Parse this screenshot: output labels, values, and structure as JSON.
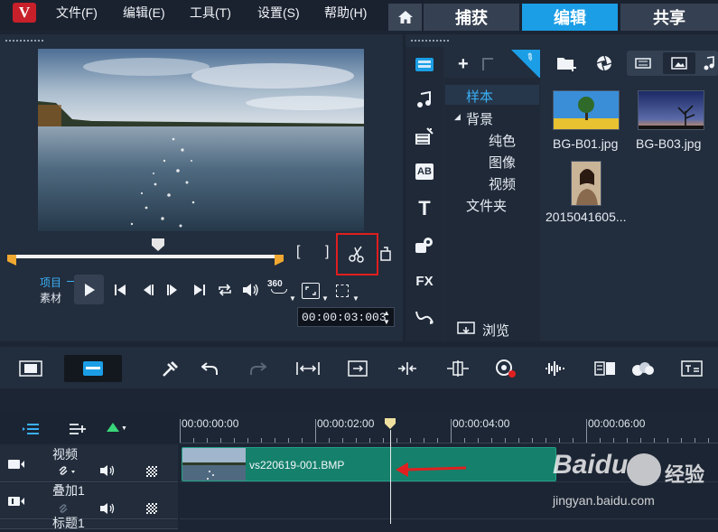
{
  "menu": {
    "logo": "V",
    "items": [
      "文件(F)",
      "编辑(E)",
      "工具(T)",
      "设置(S)",
      "帮助(H)"
    ]
  },
  "tabs": {
    "capture": "捕获",
    "edit": "编辑",
    "share": "共享"
  },
  "player": {
    "mode_project": "项目",
    "mode_clip": "素材",
    "timecode": "00:00:03:003",
    "mark_in": "[",
    "mark_out": "]",
    "label_360": "360"
  },
  "library": {
    "add_label": "+",
    "tree": {
      "sample": "样本",
      "background": "背景",
      "solid_color": "纯色",
      "image": "图像",
      "video": "视频",
      "folder": "文件夹"
    },
    "browse": "浏览",
    "thumbs": [
      {
        "name": "BG-B01.jpg"
      },
      {
        "name": "BG-B03.jpg"
      },
      {
        "name": "2015041605..."
      }
    ],
    "side_icons": [
      "media-icon",
      "music-icon",
      "transition-icon",
      "title-ab-icon",
      "text-icon",
      "graphic-icon",
      "fx-icon",
      "path-icon"
    ],
    "side_labels": {
      "title": "AB",
      "text": "T",
      "fx": "FX"
    }
  },
  "timeline": {
    "ruler": [
      "00:00:00:00",
      "00:00:02:00",
      "00:00:04:00",
      "00:00:06:00"
    ],
    "tracks": [
      {
        "name": "视频"
      },
      {
        "name": "叠加1"
      },
      {
        "name": "标题1"
      }
    ],
    "clip_name": "vs220619-001.BMP"
  },
  "colors": {
    "accent": "#1b9ee6",
    "clip": "#15806b",
    "highlight": "#e01e1e",
    "arrow": "#e02020"
  },
  "watermark": {
    "brand": "Baidu",
    "sub": "经验",
    "url": "jingyan.baidu.com"
  }
}
